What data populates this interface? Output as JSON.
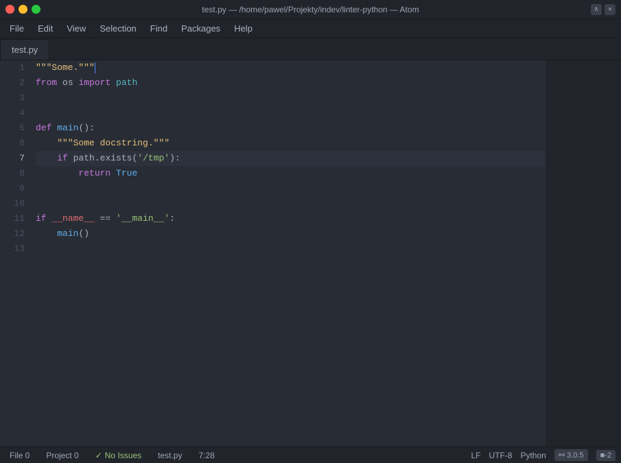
{
  "titlebar": {
    "title": "test.py — /home/pawel/Projekty/indev/linter-python — Atom",
    "buttons": {
      "close": "●",
      "minimize": "●",
      "maximize": "●"
    }
  },
  "menubar": {
    "items": [
      "File",
      "Edit",
      "View",
      "Selection",
      "Find",
      "Packages",
      "Help"
    ]
  },
  "tab": {
    "label": "test.py"
  },
  "code": {
    "lines": [
      {
        "num": "1",
        "content": "docstring_open",
        "highlighted": false
      },
      {
        "num": "2",
        "content": "import_line",
        "highlighted": false
      },
      {
        "num": "3",
        "content": "empty",
        "highlighted": false
      },
      {
        "num": "4",
        "content": "empty",
        "highlighted": false
      },
      {
        "num": "5",
        "content": "def_main",
        "highlighted": false
      },
      {
        "num": "6",
        "content": "docstring_inner",
        "highlighted": false
      },
      {
        "num": "7",
        "content": "if_path",
        "highlighted": true
      },
      {
        "num": "8",
        "content": "return_true",
        "highlighted": false
      },
      {
        "num": "9",
        "content": "empty",
        "highlighted": false
      },
      {
        "num": "10",
        "content": "empty",
        "highlighted": false
      },
      {
        "num": "11",
        "content": "if_name",
        "highlighted": false
      },
      {
        "num": "12",
        "content": "main_call",
        "highlighted": false
      },
      {
        "num": "13",
        "content": "empty",
        "highlighted": false
      }
    ]
  },
  "statusbar": {
    "file_label": "File 0",
    "project_label": "Project 0",
    "no_issues_check": "✓",
    "no_issues_label": "No Issues",
    "filename": "test.py",
    "cursor_pos": "7:28",
    "line_ending": "LF",
    "encoding": "UTF-8",
    "language": "Python",
    "git_branch": " 3.0.5",
    "git_status": "-2"
  }
}
